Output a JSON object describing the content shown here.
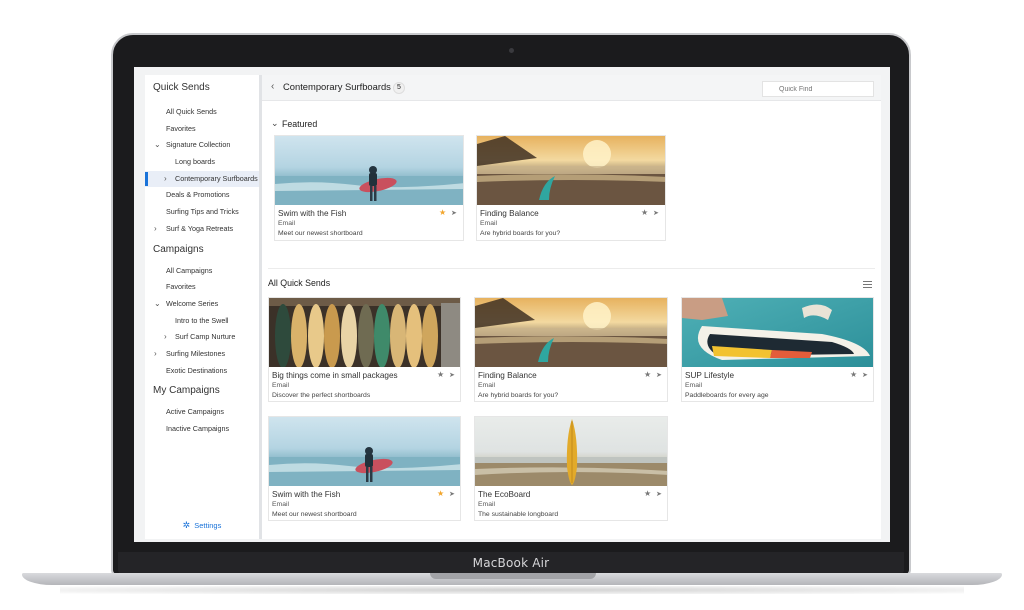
{
  "device": {
    "label": "MacBook Air"
  },
  "sidebar": {
    "sections": [
      {
        "title": "Quick Sends",
        "items": [
          {
            "label": "All Quick Sends"
          },
          {
            "label": "Favorites"
          },
          {
            "label": "Signature Collection"
          },
          {
            "label": "Long boards"
          },
          {
            "label": "Contemporary Surfboards"
          },
          {
            "label": "Deals & Promotions"
          },
          {
            "label": "Surfing Tips and Tricks"
          },
          {
            "label": "Surf & Yoga Retreats"
          }
        ]
      },
      {
        "title": "Campaigns",
        "items": [
          {
            "label": "All Campaigns"
          },
          {
            "label": "Favorites"
          },
          {
            "label": "Welcome Series"
          },
          {
            "label": "Intro to the Swell"
          },
          {
            "label": "Surf Camp Nurture"
          },
          {
            "label": "Surfing Milestones"
          },
          {
            "label": "Exotic Destinations"
          }
        ]
      },
      {
        "title": "My Campaigns",
        "items": [
          {
            "label": "Active Campaigns"
          },
          {
            "label": "Inactive Campaigns"
          }
        ]
      }
    ],
    "active_item": "Contemporary Surfboards",
    "settings_label": "Settings"
  },
  "header": {
    "back_icon": "chevron-left-icon",
    "title": "Contemporary Surfboards",
    "count": "5",
    "search_placeholder": "Quick Find"
  },
  "featured": {
    "label": "Featured",
    "cards": [
      {
        "title": "Swim with the Fish",
        "type": "Email",
        "description": "Meet our newest shortboard",
        "favorite": true
      },
      {
        "title": "Finding Balance",
        "type": "Email",
        "description": "Are hybrid boards for you?",
        "favorite": false
      }
    ]
  },
  "all_quick_sends": {
    "label": "All Quick Sends",
    "cards": [
      {
        "title": "Big things come in small packages",
        "type": "Email",
        "description": "Discover the perfect shortboards",
        "favorite": false
      },
      {
        "title": "Finding Balance",
        "type": "Email",
        "description": "Are hybrid boards for you?",
        "favorite": false
      },
      {
        "title": "SUP Lifestyle",
        "type": "Email",
        "description": "Paddleboards for every age",
        "favorite": false
      },
      {
        "title": "Swim with the Fish",
        "type": "Email",
        "description": "Meet our newest shortboard",
        "favorite": true
      },
      {
        "title": "The EcoBoard",
        "type": "Email",
        "description": "The sustainable longboard",
        "favorite": false
      }
    ]
  },
  "colors": {
    "accent": "#1a73d9",
    "favorite_star": "#f2a52c",
    "inactive_star": "#777777"
  }
}
